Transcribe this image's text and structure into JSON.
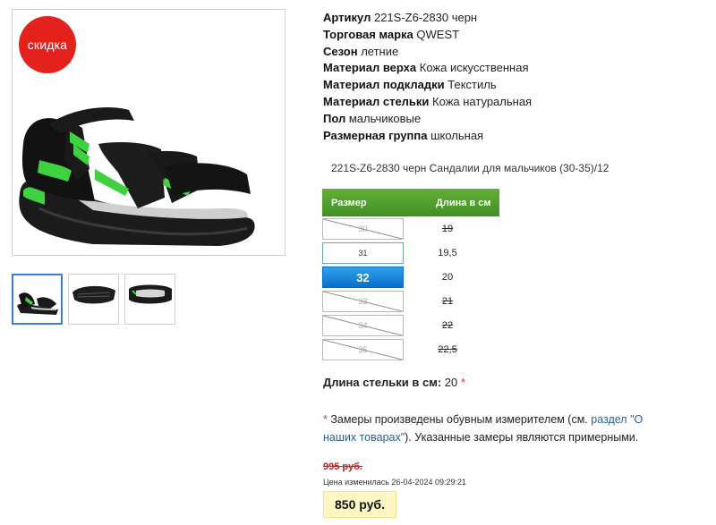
{
  "badge": {
    "label": "скидка"
  },
  "specs": [
    {
      "key": "Артикул",
      "value": "221S-Z6-2830 черн"
    },
    {
      "key": "Торговая марка",
      "value": "QWEST"
    },
    {
      "key": "Сезон",
      "value": "летние"
    },
    {
      "key": "Материал верха",
      "value": "Кожа искусственная"
    },
    {
      "key": "Материал подкладки",
      "value": "Текстиль"
    },
    {
      "key": "Материал стельки",
      "value": "Кожа натуральная"
    },
    {
      "key": "Пол",
      "value": "мальчиковые"
    },
    {
      "key": "Размерная группа",
      "value": "школьная"
    }
  ],
  "product_line": "221S-Z6-2830 черн Сандалии для мальчиков (30-35)/12",
  "size_table": {
    "col_size": "Размер",
    "col_length": "Длина в см",
    "rows": [
      {
        "size": "30",
        "length": "19",
        "available": false
      },
      {
        "size": "31",
        "length": "19,5",
        "available": true
      },
      {
        "size": "32",
        "length": "20",
        "available": true,
        "selected": true
      },
      {
        "size": "33",
        "length": "21",
        "available": false
      },
      {
        "size": "34",
        "length": "22",
        "available": false
      },
      {
        "size": "35",
        "length": "22,5",
        "available": false
      }
    ]
  },
  "insole": {
    "label": "Длина стельки в см:",
    "value": "20",
    "star": "*"
  },
  "note": {
    "star": "*",
    "text_before": " Замеры произведены обувным измерителем (см. ",
    "link": "раздел \"О наших товарах\"",
    "text_after": "). Указанные замеры являются примерными."
  },
  "old_price": "995 руб.",
  "changed": "Цена изменилась 26-04-2024 09:29:21",
  "price": "850 руб.",
  "thumbs": [
    {
      "name": "thumb-side-view"
    },
    {
      "name": "thumb-sole-view"
    },
    {
      "name": "thumb-top-view"
    }
  ]
}
